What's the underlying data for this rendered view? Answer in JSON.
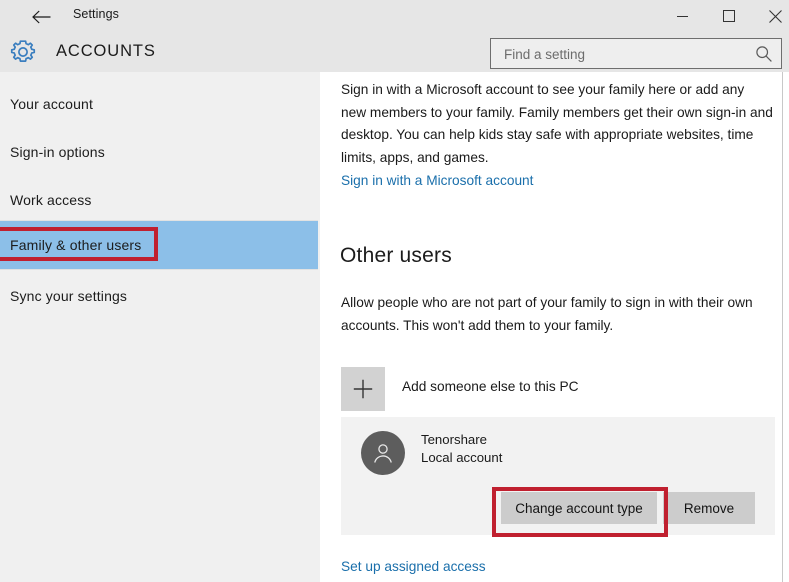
{
  "window": {
    "title": "Settings",
    "back_icon": "back-arrow-icon",
    "minimize_label": "—",
    "maximize_label": "□",
    "close_label": "✕"
  },
  "header": {
    "icon": "gear-icon",
    "title": "ACCOUNTS"
  },
  "search": {
    "placeholder": "Find a setting",
    "value": "",
    "icon": "search-icon"
  },
  "sidebar": {
    "items": [
      {
        "label": "Your account",
        "selected": false
      },
      {
        "label": "Sign-in options",
        "selected": false
      },
      {
        "label": "Work access",
        "selected": false
      },
      {
        "label": "Family & other users",
        "selected": true
      },
      {
        "label": "Sync your settings",
        "selected": false
      }
    ]
  },
  "main": {
    "intro_paragraph": "Sign in with a Microsoft account to see your family here or add any new members to your family. Family members get their own sign-in and desktop. You can help kids stay safe with appropriate websites, time limits, apps, and games.",
    "microsoft_link": "Sign in with a Microsoft account",
    "section_heading": "Other users",
    "section_paragraph": "Allow people who are not part of your family to sign in with their own accounts. This won't add them to your family.",
    "add_user": {
      "label": "Add someone else to this PC",
      "icon": "plus-icon"
    },
    "user_card": {
      "avatar_icon": "person-avatar-icon",
      "name": "Tenorshare",
      "account_type": "Local account",
      "change_button": "Change account type",
      "remove_button": "Remove"
    },
    "assigned_access_link": "Set up assigned access"
  },
  "annotations": {
    "color": "#c0202f",
    "highlights": [
      "Family & other users",
      "Change account type"
    ]
  },
  "colors": {
    "selection_blue": "#8cbfe8",
    "link_blue": "#1a6fab",
    "chrome_gray": "#e6e6e6",
    "sidebar_gray": "#f0f0f0",
    "card_gray": "#f2f2f2",
    "button_gray": "#cccccc",
    "annotation_red": "#c0202f"
  }
}
